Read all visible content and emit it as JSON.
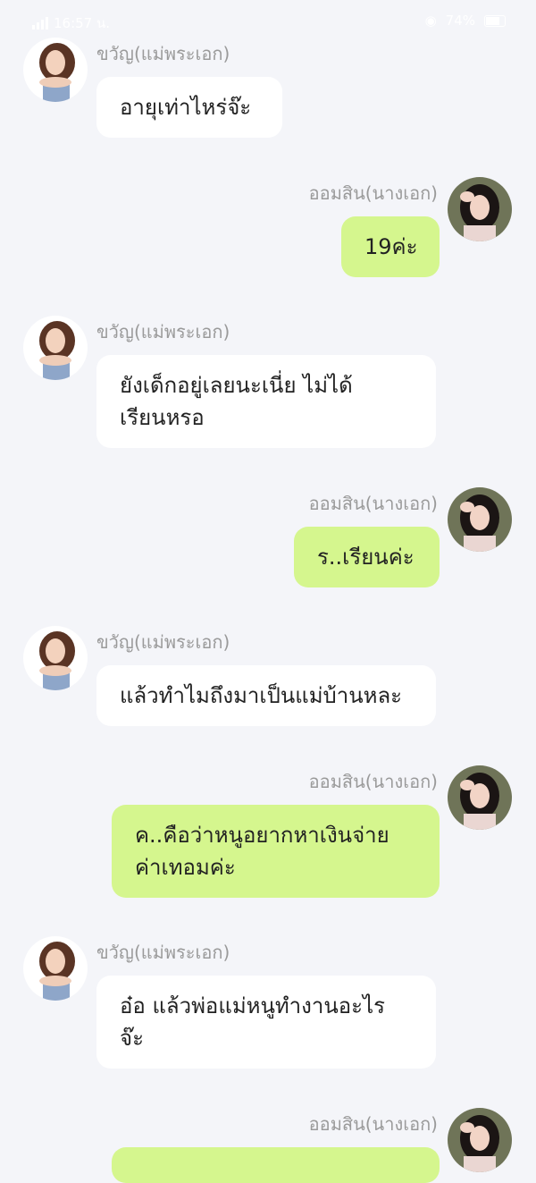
{
  "status_bar": {
    "time": "16:57 น.",
    "battery": "74%"
  },
  "chat": {
    "messages": [
      {
        "side": "incoming",
        "sender": "ขวัญ(แม่พระเอก)",
        "text": "อายุเท่าไหร่จ๊ะ"
      },
      {
        "side": "outgoing",
        "sender": "ออมสิน(นางเอก)",
        "text": "19ค่ะ"
      },
      {
        "side": "incoming",
        "sender": "ขวัญ(แม่พระเอก)",
        "text": "ยังเด็กอยู่เลยนะเนี่ย ไม่ได้\nเรียนหรอ"
      },
      {
        "side": "outgoing",
        "sender": "ออมสิน(นางเอก)",
        "text": "ร..เรียนค่ะ"
      },
      {
        "side": "incoming",
        "sender": "ขวัญ(แม่พระเอก)",
        "text": "แล้วทำไมถึงมาเป็นแม่บ้านหละ"
      },
      {
        "side": "outgoing",
        "sender": "ออมสิน(นางเอก)",
        "text": "ค..คือว่าหนูอยากหาเงินจ่าย\nค่าเทอมค่ะ"
      },
      {
        "side": "incoming",
        "sender": "ขวัญ(แม่พระเอก)",
        "text": "อ๋อ แล้วพ่อแม่หนูทำงานอะไร\nจ๊ะ"
      },
      {
        "side": "outgoing",
        "sender": "ออมสิน(นางเอก)",
        "text": ""
      }
    ]
  }
}
